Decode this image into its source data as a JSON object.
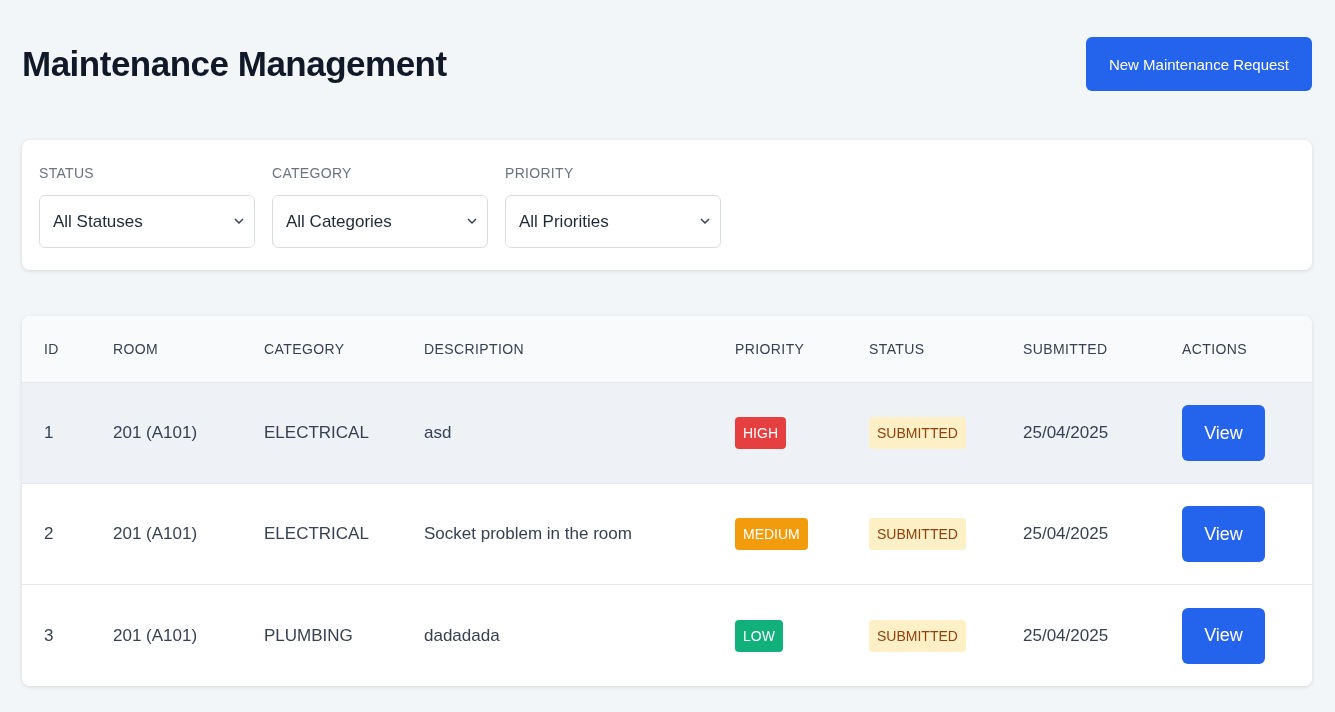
{
  "header": {
    "title": "Maintenance Management",
    "new_button": "New Maintenance Request"
  },
  "filters": [
    {
      "label": "STATUS",
      "value": "All Statuses"
    },
    {
      "label": "CATEGORY",
      "value": "All Categories"
    },
    {
      "label": "PRIORITY",
      "value": "All Priorities"
    }
  ],
  "table": {
    "columns": [
      "ID",
      "ROOM",
      "CATEGORY",
      "DESCRIPTION",
      "PRIORITY",
      "STATUS",
      "SUBMITTED",
      "ACTIONS"
    ],
    "rows": [
      {
        "id": "1",
        "room": "201 (A101)",
        "category": "ELECTRICAL",
        "description": "asd",
        "priority": {
          "label": "HIGH",
          "color": "#e5403f"
        },
        "status": {
          "label": "SUBMITTED",
          "color": "#fdf0c6"
        },
        "submitted": "25/04/2025",
        "action": "View",
        "highlighted": true
      },
      {
        "id": "2",
        "room": "201 (A101)",
        "category": "ELECTRICAL",
        "description": "Socket problem in the room",
        "priority": {
          "label": "MEDIUM",
          "color": "#f29b0d"
        },
        "status": {
          "label": "SUBMITTED",
          "color": "#fdf0c6"
        },
        "submitted": "25/04/2025",
        "action": "View",
        "highlighted": false
      },
      {
        "id": "3",
        "room": "201 (A101)",
        "category": "PLUMBING",
        "description": "dadadada",
        "priority": {
          "label": "LOW",
          "color": "#12b07a"
        },
        "status": {
          "label": "SUBMITTED",
          "color": "#fdf0c6"
        },
        "submitted": "25/04/2025",
        "action": "View",
        "highlighted": false
      }
    ]
  }
}
